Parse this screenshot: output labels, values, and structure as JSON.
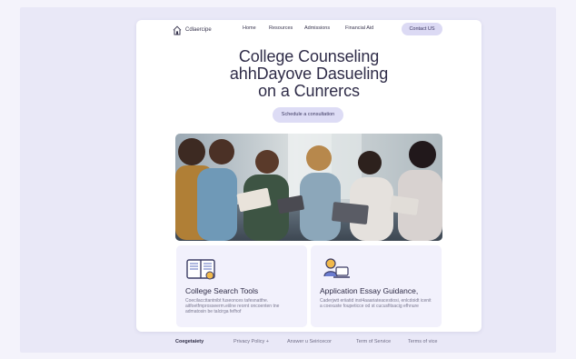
{
  "colors": {
    "page_bg": "#f4f3fb",
    "frame_bg": "#e9e8f7",
    "card_bg": "#ffffff",
    "accent_soft": "#dcdaf4",
    "feature_bg": "#f2f1fc"
  },
  "nav": {
    "brand": "Cdlaercipe",
    "links": [
      "Home",
      "Resources",
      "Admissions",
      "Financial Aid"
    ],
    "cta": "Contact US"
  },
  "hero": {
    "title_lines": [
      "College Counseling",
      "ahhDayove Dasueling",
      "on a Cunrercs"
    ],
    "button": "Schedule a consultation"
  },
  "features": [
    {
      "title": "College Search Tools",
      "description": "Coecilaccttantnibt fuseonces tafesnatthe. aitfoetfmprosseerm.eiilne reornt oncoenten tne admatosin be talcirga fefhof",
      "icon": "book-icon"
    },
    {
      "title": "Application Essay Guidance,",
      "description": "Caderjwtt eriiatid inst4aaariateacestiosi, enlcdoidt icenit a coexuste foupeticce od st cucusfitsacig efhnure",
      "icon": "person-laptop-icon"
    }
  ],
  "footer": {
    "brand": "Coegetaiety",
    "links": [
      "Privacy Policy +",
      "Answer u Seiricecor",
      "Term of Service",
      "Terms of vice"
    ]
  }
}
